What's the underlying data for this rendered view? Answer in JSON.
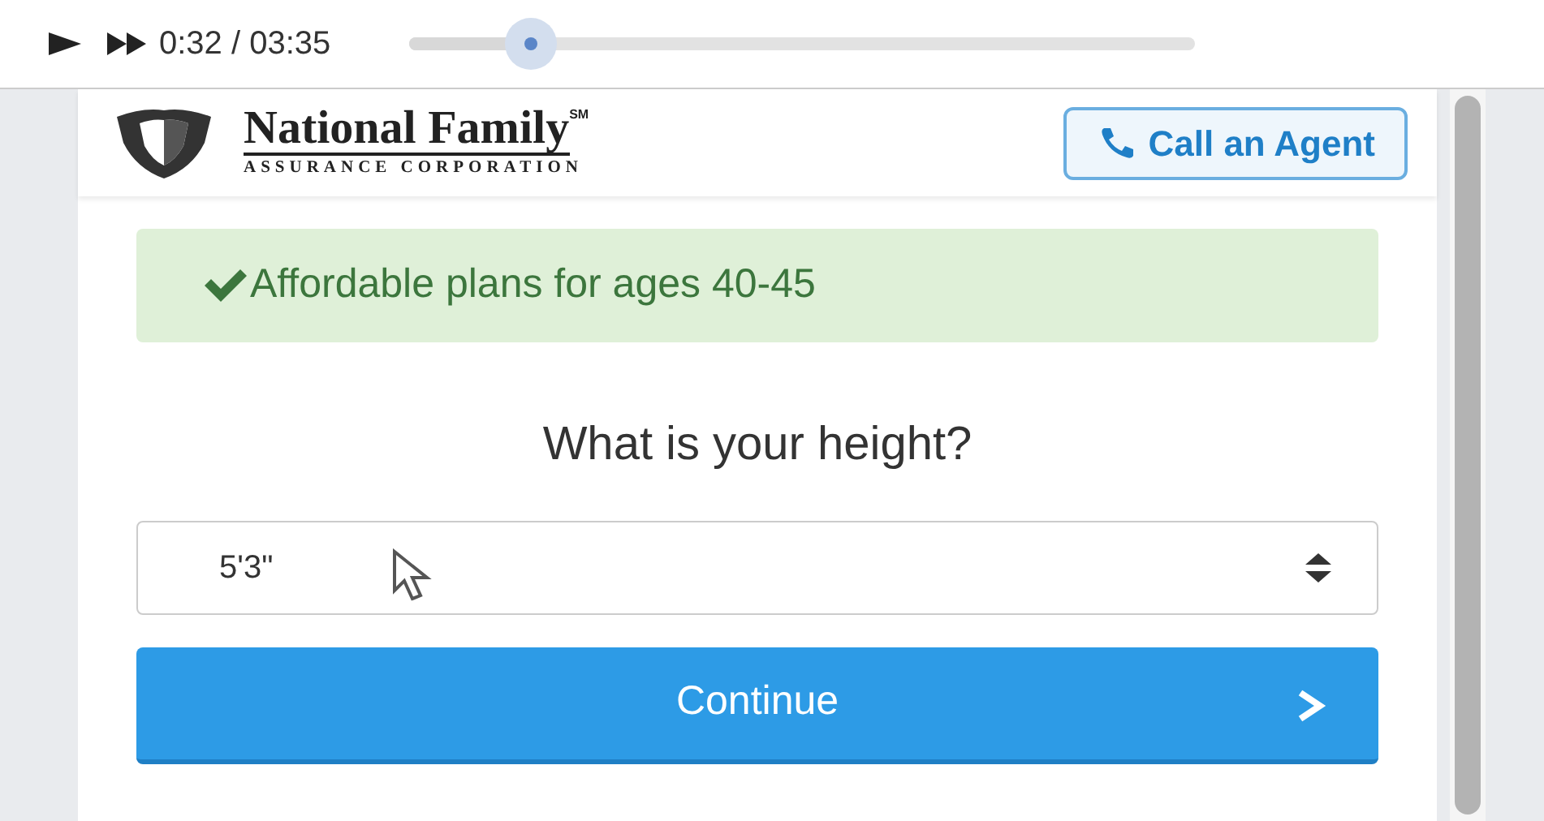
{
  "player": {
    "time": "0:32 / 03:35",
    "level": 0.155
  },
  "header": {
    "logo_title": "National Family",
    "logo_mark": "SM",
    "logo_subtitle": "ASSURANCE CORPORATION",
    "call_button": "Call an Agent"
  },
  "alert": {
    "text": "Affordable plans for ages 40-45"
  },
  "question": "What is your height?",
  "select": {
    "value": "5'3\""
  },
  "continue_button": {
    "label": "Continue"
  }
}
